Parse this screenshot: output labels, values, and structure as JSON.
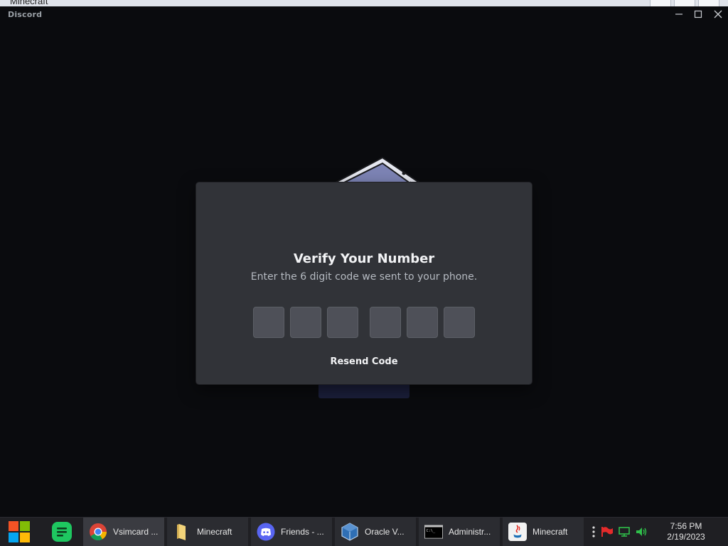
{
  "background_window": {
    "title": "Minecraft"
  },
  "discord": {
    "app_title": "Discord",
    "window_controls": {
      "minimize": "—",
      "maximize": "☐",
      "close": "✕"
    }
  },
  "modal": {
    "title": "Verify Your Number",
    "subtitle": "Enter the 6 digit code we sent to your phone.",
    "code_length": 6,
    "code_values": [
      "",
      "",
      "",
      "",
      "",
      ""
    ],
    "resend_label": "Resend Code"
  },
  "taskbar": {
    "items": [
      {
        "label": "Vsimcard ...",
        "icon": "chrome-icon",
        "active": true
      },
      {
        "label": "Minecraft",
        "icon": "folder-icon",
        "active": false
      },
      {
        "label": "Friends - ...",
        "icon": "discord-icon",
        "active": false
      },
      {
        "label": "Oracle V...",
        "icon": "virtualbox-icon",
        "active": false
      },
      {
        "label": "Administr...",
        "icon": "cmd-icon",
        "active": false
      },
      {
        "label": "Minecraft",
        "icon": "java-icon",
        "active": false
      }
    ],
    "clock": {
      "time": "7:56 PM",
      "date": "2/19/2023"
    }
  },
  "colors": {
    "modal_bg": "#313338",
    "input_bg": "#4e5058",
    "taskbar_bg": "#1f1f23",
    "discord_blurple": "#5865f2"
  }
}
